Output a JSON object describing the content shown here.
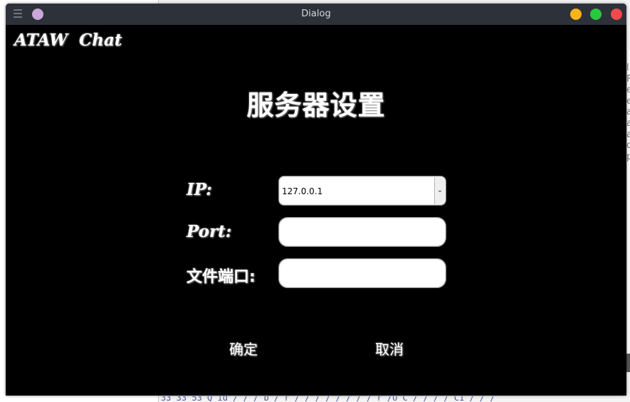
{
  "window": {
    "title": "Dialog"
  },
  "app": {
    "brand": "ATAW  Chat",
    "heading": "服务器设置"
  },
  "form": {
    "ip_label": "IP:",
    "ip_value": "127.0.0.1",
    "port_label": "Port:",
    "port_value": "",
    "file_port_label": "文件端口:",
    "file_port_value": ""
  },
  "buttons": {
    "ok": "确定",
    "cancel": "取消"
  },
  "background": {
    "right_letters": "l\nF\ne\ne\na\na\na\nc\np",
    "bottom_text": "33 33 53  Q    id    /    /    /   b  /  r  / /  /  /   /  /   /  / r    /U  C  /  /  /   /  C1  /   /   /"
  },
  "colors": {
    "titlebar": "#2d3139",
    "window_bg": "#000000",
    "minimize": "#fbb31c",
    "maximize": "#29c93f",
    "close": "#f04a4a",
    "pin": "#c9a7d6"
  },
  "icons": {
    "menu": "hamburger-icon",
    "dropdown": "chevron-down-icon"
  }
}
